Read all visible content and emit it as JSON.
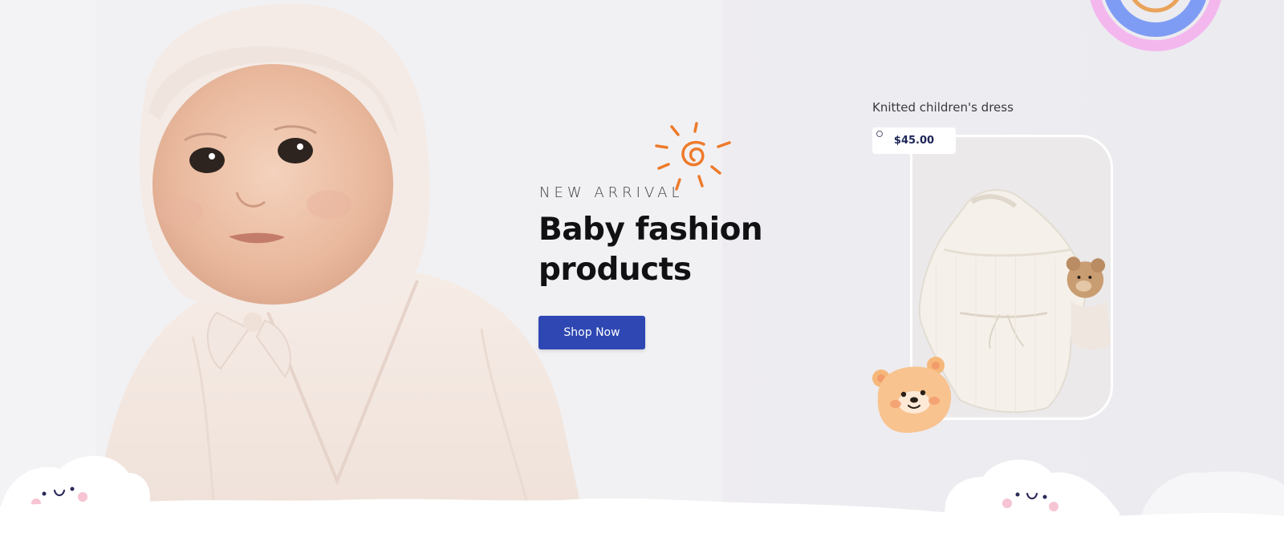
{
  "hero": {
    "eyebrow": "NEW ARRIVAL",
    "headline": "Baby fashion products",
    "cta_label": "Shop Now"
  },
  "product": {
    "name": "Knitted children's dress",
    "price": "$45.00"
  },
  "colors": {
    "background": "#ecebf0",
    "accent": "#2f47b3",
    "sun": "#ee7a2a",
    "bear": "#f6b87a"
  },
  "icons": [
    "sun-icon",
    "rainbow-icon",
    "bear-icon",
    "cloud-face-icon"
  ]
}
